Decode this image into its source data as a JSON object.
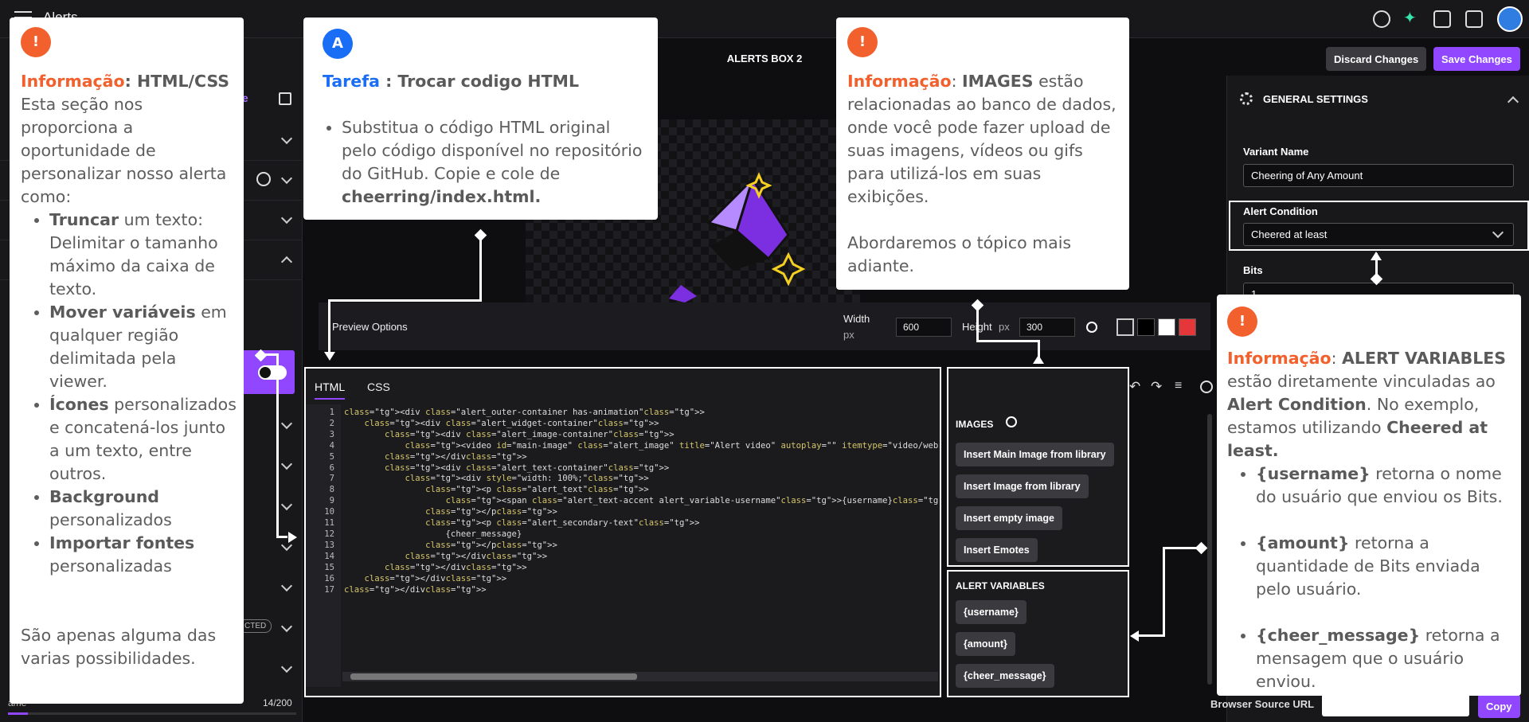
{
  "app": {
    "title": "Alerts"
  },
  "header": {
    "box_title": "ALERTS BOX 2",
    "discard_label": "Discard Changes",
    "save_label": "Save Changes",
    "discard_color": "#3a3a3f",
    "save_color": "#9147ff"
  },
  "sidebar": {
    "enable_fragment": "le",
    "selected_fragment": "CTED",
    "char_count": "14/200",
    "bottom_fragment": "ame"
  },
  "preview": {
    "label": "Preview Options",
    "width_label": "Width",
    "width_unit": "px",
    "width_value": "600",
    "height_label": "Height",
    "height_unit": "px",
    "height_value": "300",
    "swatch_colors": [
      "#1c1c20",
      "#000000",
      "#ffffff",
      "#e5363a"
    ]
  },
  "editor": {
    "tabs": [
      "HTML",
      "CSS"
    ],
    "line_numbers": "1\n2\n3\n4\n5\n6\n7\n8\n9\n10\n11\n12\n13\n14\n15\n16\n17",
    "code_lines": [
      "<div class=\"alert_outer-container has-animation\">",
      "    <div class=\"alert_widget-container\">",
      "        <div class=\"alert_image-container\">",
      "            <video id=\"main-image\" class=\"alert_image\" title=\"Alert video\" autoplay=\"\" itemtype=\"video/webm\"><sou",
      "        </div>",
      "        <div class=\"alert_text-container\">",
      "            <div style=\"width: 100%;\">",
      "                <p class=\"alert_text\">",
      "                    <span class=\"alert_text-accent alert_variable-username\">{username}</span> just Cheered <span",
      "                </p>",
      "                <p class=\"alert_secondary-text\">",
      "                    {cheer_message}",
      "                </p>",
      "            </div>",
      "        </div>",
      "    </div>",
      "</div>"
    ]
  },
  "images_panel": {
    "title": "IMAGES",
    "items": [
      "Insert Main Image from library",
      "Insert Image from library",
      "Insert empty image",
      "Insert Emotes"
    ]
  },
  "variables_panel": {
    "title": "ALERT VARIABLES",
    "items": [
      "{username}",
      "{amount}",
      "{cheer_message}"
    ]
  },
  "settings": {
    "section_title": "GENERAL SETTINGS",
    "variant_label": "Variant Name",
    "variant_value": "Cheering of Any Amount",
    "condition_label": "Alert Condition",
    "condition_value": "Cheered at least",
    "bits_label": "Bits",
    "bits_value": "1",
    "browser_source_label": "Browser Source URL",
    "copy_label": "Copy"
  },
  "callouts": {
    "html_css": {
      "badge": "!",
      "kicker": "Informação",
      "title": ": HTML/CSS",
      "intro": "Esta seção nos proporciona a oportunidade de personalizar nosso alerta como:",
      "items": [
        {
          "bold": "Truncar",
          "text": " um texto: Delimitar o tamanho máximo da caixa de texto."
        },
        {
          "bold": "Mover variáveis",
          "text": " em qualquer região delimitada pela viewer."
        },
        {
          "bold": "Ícones",
          "text": " personalizados e concatená-los junto a um texto, entre outros."
        },
        {
          "bold": "Background",
          "text": " personalizados"
        },
        {
          "bold": "Importar fontes",
          "text": " personalizadas"
        }
      ],
      "outro": "São apenas alguma das varias possibilidades."
    },
    "task": {
      "badge": "A",
      "kicker": "Tarefa",
      "title": " : Trocar codigo HTML",
      "text": "Substitua o código HTML original pelo código disponível no repositório do GitHub. Copie e cole de ",
      "bold": "cheerring/index.html."
    },
    "images": {
      "badge": "!",
      "kicker": "Informação",
      "title_sep": ": ",
      "title_bold": "IMAGES",
      "text": " estão relacionadas ao banco de dados, onde você pode fazer upload de suas imagens, vídeos ou gifs para utilizá-los em suas exibições.",
      "text2": "Abordaremos o tópico mais adiante."
    },
    "variables": {
      "badge": "!",
      "kicker": "Informação",
      "title_sep": ": ",
      "title_bold": "ALERT VARIABLES",
      "text_a": " estão diretamente vinculadas ao ",
      "bold_a": "Alert Condition",
      "text_b": ". No exemplo, estamos utilizando ",
      "bold_b": "Cheered at least.",
      "items": [
        {
          "bold": "{username}",
          "text": " retorna o nome do usuário que enviou os Bits."
        },
        {
          "bold": "{amount}",
          "text": " retorna a quantidade de Bits enviada pelo usuário."
        },
        {
          "bold": "{cheer_message}",
          "text": " retorna a mensagem que o usuário enviou."
        }
      ]
    }
  }
}
